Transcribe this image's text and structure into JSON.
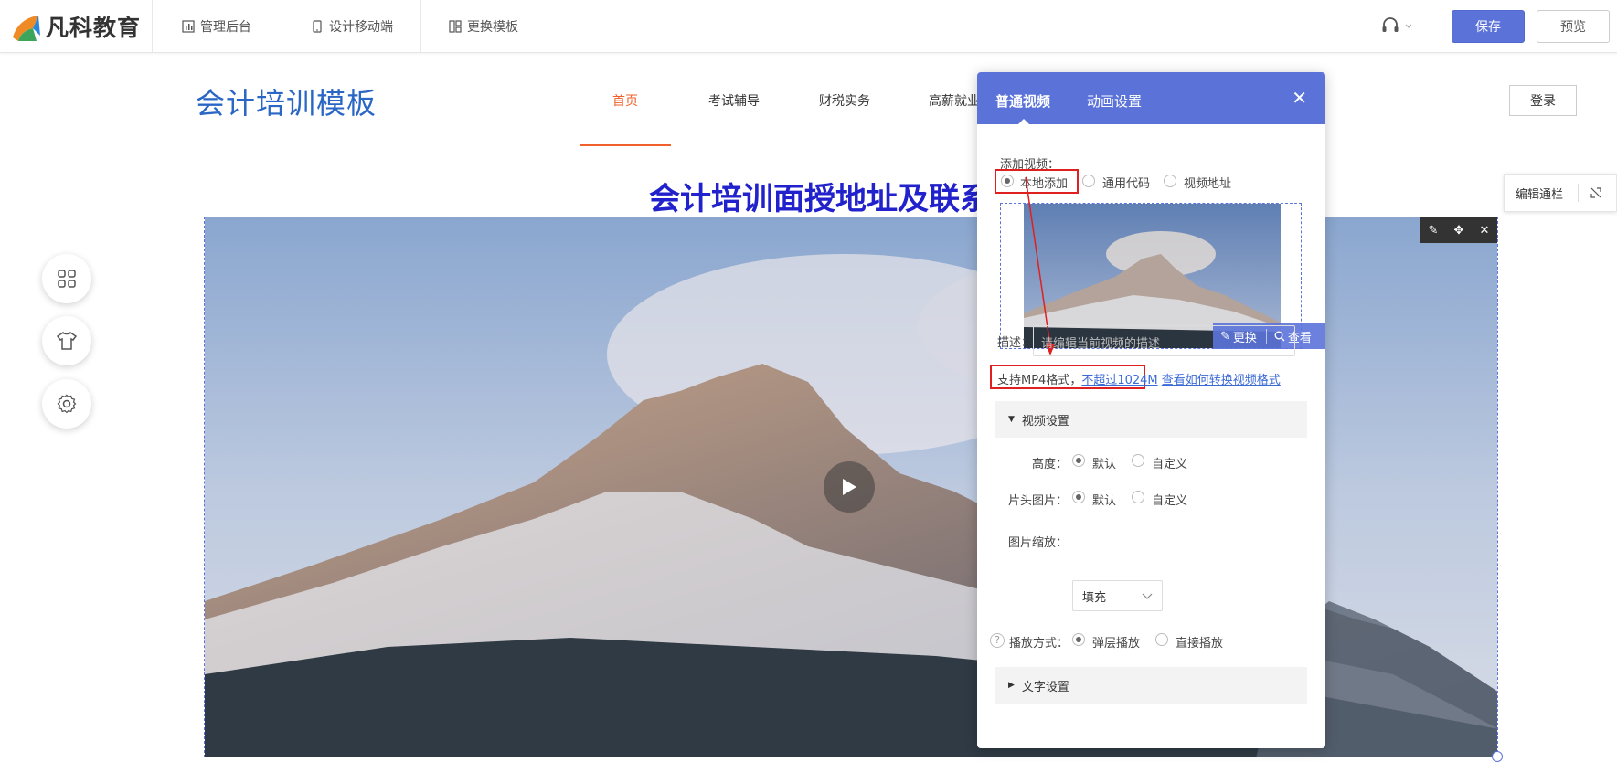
{
  "app": {
    "logo_text": "凡科教育",
    "top_nav": [
      "管理后台",
      "设计移动端",
      "更换模板"
    ],
    "save_label": "保存",
    "preview_label": "预览"
  },
  "site": {
    "title": "会计培训模板",
    "nav": [
      "首页",
      "考试辅导",
      "财税实务",
      "高薪就业"
    ],
    "login_label": "登录",
    "heading": "会计培训面授地址及联系"
  },
  "edit_column": {
    "label": "编辑通栏"
  },
  "panel": {
    "tabs": [
      "普通视频",
      "动画设置"
    ],
    "add_video_label": "添加视频：",
    "source_options": [
      "本地添加",
      "通用代码",
      "视频地址"
    ],
    "selected_source": "本地添加",
    "thumb_replace": "更换",
    "thumb_view": "查看",
    "desc_label": "描述：",
    "desc_placeholder": "请编辑当前视频的描述",
    "format_note_prefix": "支持MP4格式，",
    "format_limit_link": "不超过1024M",
    "format_help_link": "查看如何转换视频格式",
    "video_settings_label": "视频设置",
    "height_label": "高度：",
    "height_options": [
      "默认",
      "自定义"
    ],
    "cover_label": "片头图片：",
    "cover_options": [
      "默认",
      "自定义"
    ],
    "scale_label": "图片缩放：",
    "scale_value": "填充",
    "play_label": "播放方式：",
    "play_options": [
      "弹层播放",
      "直接播放"
    ],
    "text_settings_label": "文字设置"
  },
  "colors": {
    "accent": "#5b73d9",
    "active_nav": "#f0602a",
    "highlight_box": "#e02020",
    "heading": "#2222cc"
  }
}
